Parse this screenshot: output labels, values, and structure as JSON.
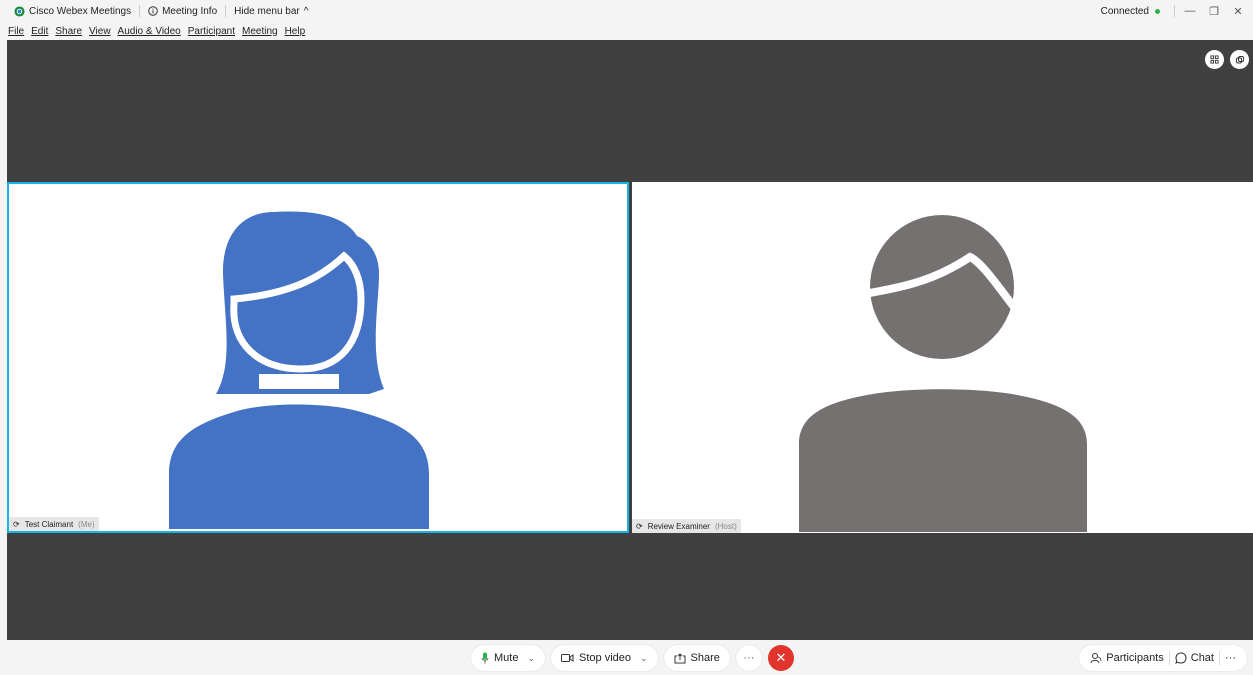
{
  "titlebar": {
    "app_name": "Cisco Webex Meetings",
    "meeting_info": "Meeting Info",
    "hide_menu_bar": "Hide menu bar",
    "status": "Connected",
    "status_color": "#2fb24c"
  },
  "menu": [
    "File",
    "Edit",
    "Share",
    "View",
    "Audio & Video",
    "Participant",
    "Meeting",
    "Help"
  ],
  "participants": [
    {
      "name": "Test Claimant",
      "role": "(Me)",
      "avatar_color": "#4472c4",
      "active": true
    },
    {
      "name": "Review Examiner",
      "role": "(Host)",
      "avatar_color": "#767171",
      "active": false
    }
  ],
  "controls": {
    "mute": "Mute",
    "stop_video": "Stop video",
    "share": "Share",
    "more": "···",
    "end_icon": "close-icon"
  },
  "side_controls": {
    "participants": "Participants",
    "chat": "Chat",
    "more": "···"
  },
  "colors": {
    "stage_bg": "#404040",
    "active_border": "#18b4e8",
    "end_call": "#e0342c"
  }
}
